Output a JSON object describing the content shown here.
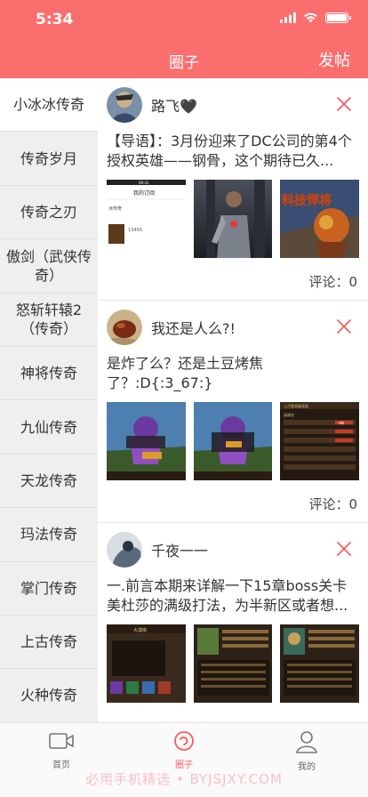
{
  "status_bar": {
    "time": "5:34"
  },
  "header": {
    "title": "圈子",
    "post_label": "发帖"
  },
  "sidebar": {
    "items": [
      {
        "label": "小冰冰传奇"
      },
      {
        "label": "传奇岁月"
      },
      {
        "label": "传奇之刃"
      },
      {
        "label": "傲剑（武侠传奇）"
      },
      {
        "label": "怒斩轩辕2（传奇）"
      },
      {
        "label": "神将传奇"
      },
      {
        "label": "九仙传奇"
      },
      {
        "label": "天龙传奇"
      },
      {
        "label": "玛法传奇"
      },
      {
        "label": "掌门传奇"
      },
      {
        "label": "上古传奇"
      },
      {
        "label": "火种传奇"
      }
    ]
  },
  "posts": [
    {
      "username": "路飞🖤",
      "text": "【导语】：3月份迎来了DC公司的第4个授权英雄——钢骨，这个期待已久...",
      "thumb_texts": [
        "09:41",
        "我的订阅",
        "冰传奇",
        "13456",
        "科技悍将"
      ],
      "comments_label": "评论：",
      "comments": "0"
    },
    {
      "username": "我还是人么?!",
      "text": "是炸了么？还是土豆烤焦了？:D{:3_67:}",
      "thumb_texts": [
        "上古登录器奖励",
        "英雄名",
        "领取"
      ],
      "comments_label": "评论：",
      "comments": "0"
    },
    {
      "username": "千夜一一",
      "text": "一.前言本期来详解一下15章boss关卡美杜莎的满级打法，为半新区或者想...",
      "thumb_texts": [
        "大漠南"
      ],
      "comments_label": "评论：",
      "comments": "0"
    }
  ],
  "tabbar": {
    "tabs": [
      {
        "label": "首页"
      },
      {
        "label": "圈子"
      },
      {
        "label": "我的"
      }
    ],
    "watermark": "必用手机精选 • BYJSJXY.COM"
  },
  "colors": {
    "accent": "#fb6e6e",
    "active_tab": "#fb5c5c",
    "sidebar_bg": "#efefef"
  }
}
